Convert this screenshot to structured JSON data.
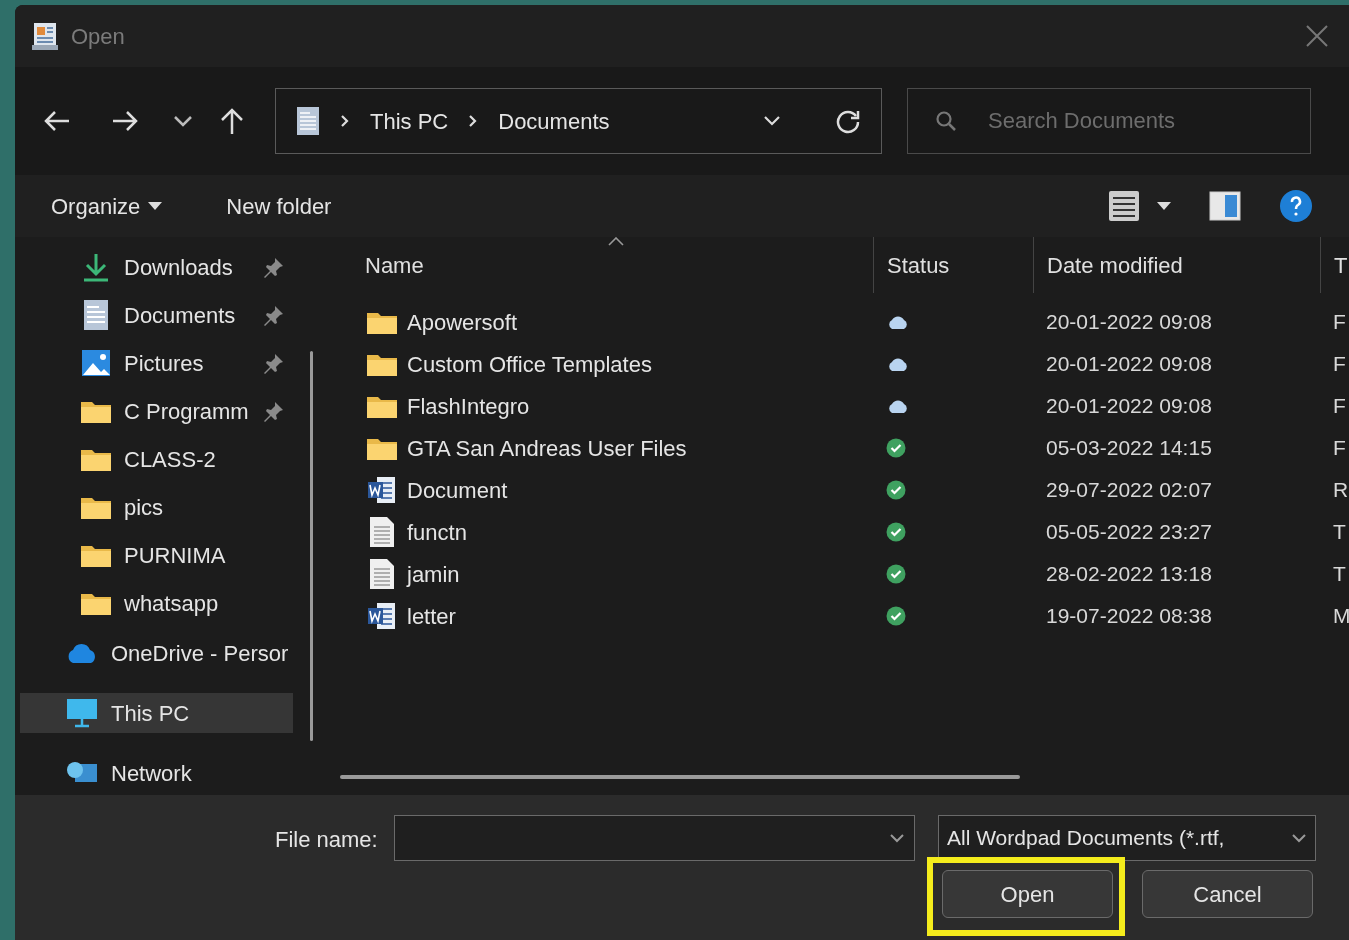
{
  "window": {
    "title": "Open"
  },
  "address_bar": {
    "segments": [
      "This PC",
      "Documents"
    ]
  },
  "search": {
    "placeholder": "Search Documents"
  },
  "toolbar": {
    "organize": "Organize",
    "new_folder": "New folder"
  },
  "sidebar": {
    "quick_access": [
      {
        "label": "Downloads",
        "kind": "download",
        "pinned": true,
        "selected": false
      },
      {
        "label": "Documents",
        "kind": "document",
        "pinned": true,
        "selected": false
      },
      {
        "label": "Pictures",
        "kind": "pictures",
        "pinned": true,
        "selected": false
      },
      {
        "label": "C Programm",
        "kind": "folder",
        "pinned": true,
        "selected": false
      },
      {
        "label": "CLASS-2",
        "kind": "folder",
        "pinned": false,
        "selected": false
      },
      {
        "label": "pics",
        "kind": "folder",
        "pinned": false,
        "selected": false
      },
      {
        "label": "PURNIMA",
        "kind": "folder",
        "pinned": false,
        "selected": false
      },
      {
        "label": "whatsapp",
        "kind": "folder",
        "pinned": false,
        "selected": false
      }
    ],
    "locations": [
      {
        "label": "OneDrive - Persor",
        "kind": "cloud",
        "selected": false
      },
      {
        "label": "This PC",
        "kind": "pc",
        "selected": true
      },
      {
        "label": "Network",
        "kind": "network",
        "selected": false
      }
    ]
  },
  "table": {
    "columns": [
      "Name",
      "Status",
      "Date modified",
      "T"
    ],
    "rows": [
      {
        "name": "Apowersoft",
        "kind": "folder",
        "synced": false,
        "date": "20-01-2022 09:08",
        "column_4": "F"
      },
      {
        "name": "Custom Office Templates",
        "kind": "folder",
        "synced": false,
        "date": "20-01-2022 09:08",
        "column_4": "F"
      },
      {
        "name": "FlashIntegro",
        "kind": "folder",
        "synced": false,
        "date": "20-01-2022 09:08",
        "column_4": "F"
      },
      {
        "name": "GTA San Andreas User Files",
        "kind": "folder",
        "synced": true,
        "date": "05-03-2022 14:15",
        "column_4": "F"
      },
      {
        "name": "Document",
        "kind": "word",
        "synced": true,
        "date": "29-07-2022 02:07",
        "column_4": "R"
      },
      {
        "name": "functn",
        "kind": "text",
        "synced": true,
        "date": "05-05-2022 23:27",
        "column_4": "T"
      },
      {
        "name": "jamin",
        "kind": "text",
        "synced": true,
        "date": "28-02-2022 13:18",
        "column_4": "T"
      },
      {
        "name": "letter",
        "kind": "word",
        "synced": true,
        "date": "19-07-2022 08:38",
        "column_4": "M"
      }
    ]
  },
  "footer": {
    "file_name_label": "File name:",
    "file_type": "All Wordpad Documents (*.rtf,",
    "buttons": [
      {
        "label": "Open",
        "highlighted": true
      },
      {
        "label": "Cancel",
        "highlighted": false
      }
    ]
  }
}
